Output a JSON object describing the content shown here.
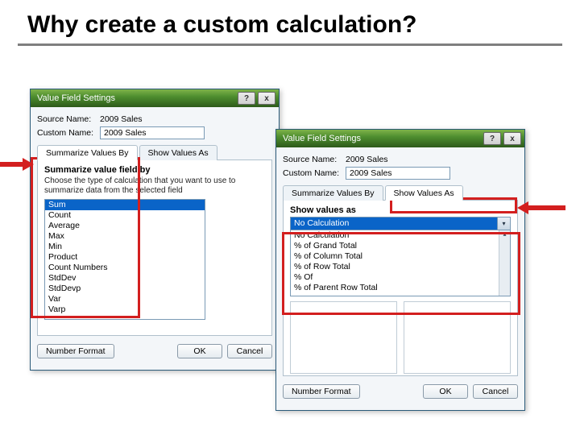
{
  "slide": {
    "title": "Why create a custom calculation?"
  },
  "dialog1": {
    "title": "Value Field Settings",
    "source_label": "Source Name:",
    "source_value": "2009 Sales",
    "custom_label": "Custom Name:",
    "custom_value": "2009 Sales",
    "tab1": "Summarize Values By",
    "tab2": "Show Values As",
    "section": "Summarize value field by",
    "desc": "Choose the type of calculation that you want to use to summarize data from the selected field",
    "items": [
      "Sum",
      "Count",
      "Average",
      "Max",
      "Min",
      "Product",
      "Count Numbers",
      "StdDev",
      "StdDevp",
      "Var",
      "Varp"
    ],
    "number_format": "Number Format",
    "ok": "OK",
    "cancel": "Cancel"
  },
  "dialog2": {
    "title": "Value Field Settings",
    "source_label": "Source Name:",
    "source_value": "2009 Sales",
    "custom_label": "Custom Name:",
    "custom_value": "2009 Sales",
    "tab1": "Summarize Values By",
    "tab2": "Show Values As",
    "section": "Show values as",
    "combo_value": "No Calculation",
    "drop_items": [
      "No Calculation",
      "% of Grand Total",
      "% of Column Total",
      "% of Row Total",
      "% Of",
      "% of Parent Row Total"
    ],
    "number_format": "Number Format",
    "ok": "OK",
    "cancel": "Cancel"
  }
}
